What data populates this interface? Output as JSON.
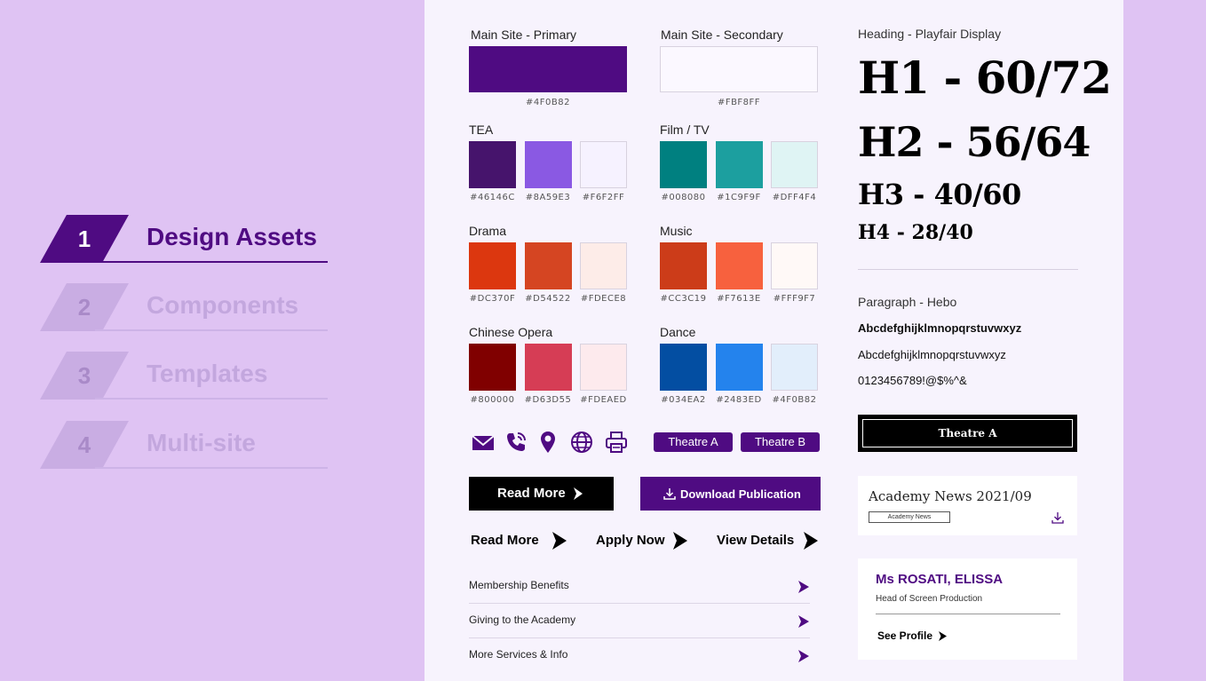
{
  "steps": [
    {
      "num": "1",
      "label": "Design Assets",
      "active": true
    },
    {
      "num": "2",
      "label": "Components",
      "active": false
    },
    {
      "num": "3",
      "label": "Templates",
      "active": false
    },
    {
      "num": "4",
      "label": "Multi-site",
      "active": false
    }
  ],
  "colors": {
    "main_primary": {
      "title": "Main Site - Primary",
      "hex": "#4F0B82"
    },
    "main_secondary": {
      "title": "Main Site - Secondary",
      "hex": "#FBF8FF"
    },
    "groups": [
      {
        "title": "TEA",
        "hexes": [
          "#46146C",
          "#8A59E3",
          "#F6F2FF"
        ]
      },
      {
        "title": "Film / TV",
        "hexes": [
          "#008080",
          "#1C9F9F",
          "#DFF4F4"
        ]
      },
      {
        "title": "Drama",
        "hexes": [
          "#DC370F",
          "#D54522",
          "#FDECE8"
        ]
      },
      {
        "title": "Music",
        "hexes": [
          "#CC3C19",
          "#F7613E",
          "#FFF9F7"
        ]
      },
      {
        "title": "Chinese Opera",
        "hexes": [
          "#800000",
          "#D63D55",
          "#FDEAED"
        ]
      },
      {
        "title": "Dance",
        "hexes": [
          "#034EA2",
          "#2483ED",
          "#4F0B82"
        ]
      }
    ],
    "dance_third_fill": "#E2EEFB",
    "accent": "#4F0B82"
  },
  "icons": [
    "mail-icon",
    "phone-icon",
    "location-pin-icon",
    "globe-icon",
    "printer-icon"
  ],
  "pills": [
    "Theatre A",
    "Theatre B"
  ],
  "buttons": {
    "read_more": "Read More",
    "download": "Download Publication"
  },
  "ctas": [
    "Read More",
    "Apply Now",
    "View Details"
  ],
  "list": [
    "Membership Benefits",
    "Giving to the Academy",
    "More Services & Info"
  ],
  "typography": {
    "heading_label": "Heading - Playfair Display",
    "h1": "H1 - 60/72",
    "h2": "H2 - 56/64",
    "h3": "H3 - 40/60",
    "h4": "H4 - 28/40",
    "paragraph_label": "Paragraph - Hebo",
    "sample_lower": "Abcdefghijklmnopqrstuvwxyz",
    "sample_regular": "Abcdefghijklmnopqrstuvwxyz",
    "sample_digits": "0123456789!@$%^&"
  },
  "theatre_button": "Theatre A",
  "news_card": {
    "title": "Academy News 2021/09",
    "tag": "Academy News"
  },
  "profile_card": {
    "name": "Ms ROSATI, ELISSA",
    "role": "Head of Screen Production",
    "link": "See Profile"
  }
}
